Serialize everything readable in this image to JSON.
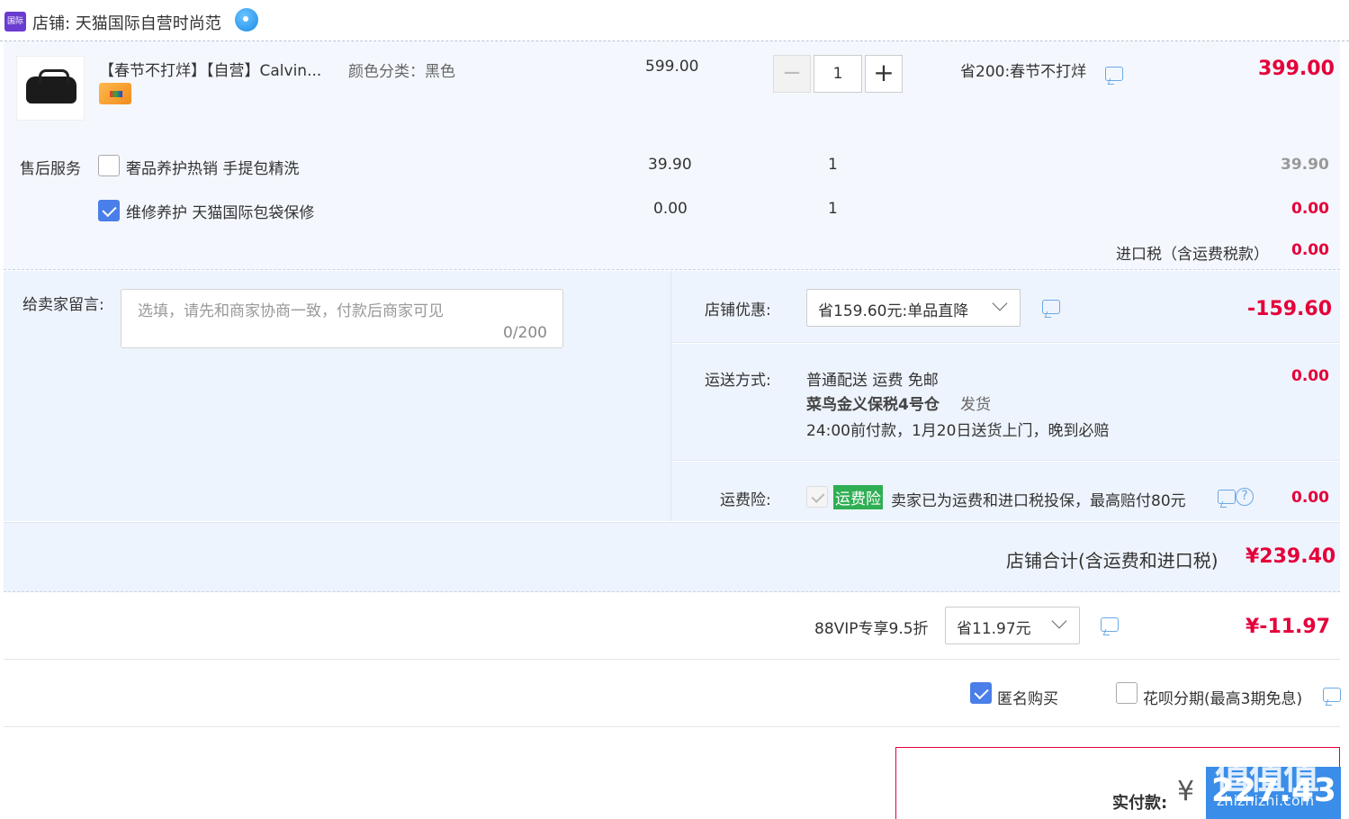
{
  "store": {
    "badge": "国际",
    "label": "店铺: 天猫国际自营时尚范"
  },
  "product": {
    "title": "【春节不打烊】【自营】Calvin...",
    "variant": "颜色分类：黑色",
    "price": "599.00",
    "quantity": "1",
    "minus": "−",
    "plus": "+",
    "promo": "省200:春节不打烊",
    "total": "399.00"
  },
  "services": {
    "label": "售后服务",
    "items": [
      {
        "label": "奢品养护热销 手提包精洗",
        "price": "39.90",
        "qty": "1",
        "total": "39.90",
        "checked": false
      },
      {
        "label": "维修养护 天猫国际包袋保修",
        "price": "0.00",
        "qty": "1",
        "total": "0.00",
        "checked": true
      }
    ]
  },
  "import_tax": {
    "label": "进口税（含运费税款）",
    "amount": "0.00"
  },
  "message": {
    "label": "给卖家留言:",
    "placeholder": "选填，请先和商家协商一致，付款后商家可见",
    "count": "0/200"
  },
  "coupon": {
    "label": "店铺优惠:",
    "selected": "省159.60元:单品直降",
    "amount": "-159.60"
  },
  "shipping": {
    "label": "运送方式:",
    "method": "普通配送 运费 免邮",
    "warehouse": "菜鸟金义保税4号仓",
    "dispatch": "发货",
    "eta": "24:00前付款，1月20日送货上门，晚到必赔",
    "fee": "0.00"
  },
  "insurance": {
    "label": "运费险:",
    "badge": "运费险",
    "text": "卖家已为运费和进口税投保，最高赔付80元",
    "help": "?",
    "fee": "0.00"
  },
  "store_total": {
    "label": "店铺合计(含运费和进口税)",
    "amount": "¥239.40"
  },
  "vip": {
    "label": "88VIP专享9.5折",
    "selected": "省11.97元",
    "amount": "¥-11.97"
  },
  "options": {
    "anonymous": "匿名购买",
    "huabei": "花呗分期(最高3期免息)"
  },
  "payment": {
    "label": "实付款:",
    "currency": "¥",
    "amount": "227.43"
  },
  "watermark": {
    "main": "值值值",
    "sub": "zhizhizhi.com"
  },
  "colors": {
    "accent_red": "#e4003a",
    "panel_bg": "#eef4fd",
    "checkbox_blue": "#4a7ee8",
    "insurance_green": "#2fae54"
  },
  "icons": [
    "store-badge-icon",
    "wangwang-chat-icon",
    "card-icon",
    "message-icon",
    "help-icon",
    "chevron-down-icon",
    "check-icon"
  ]
}
